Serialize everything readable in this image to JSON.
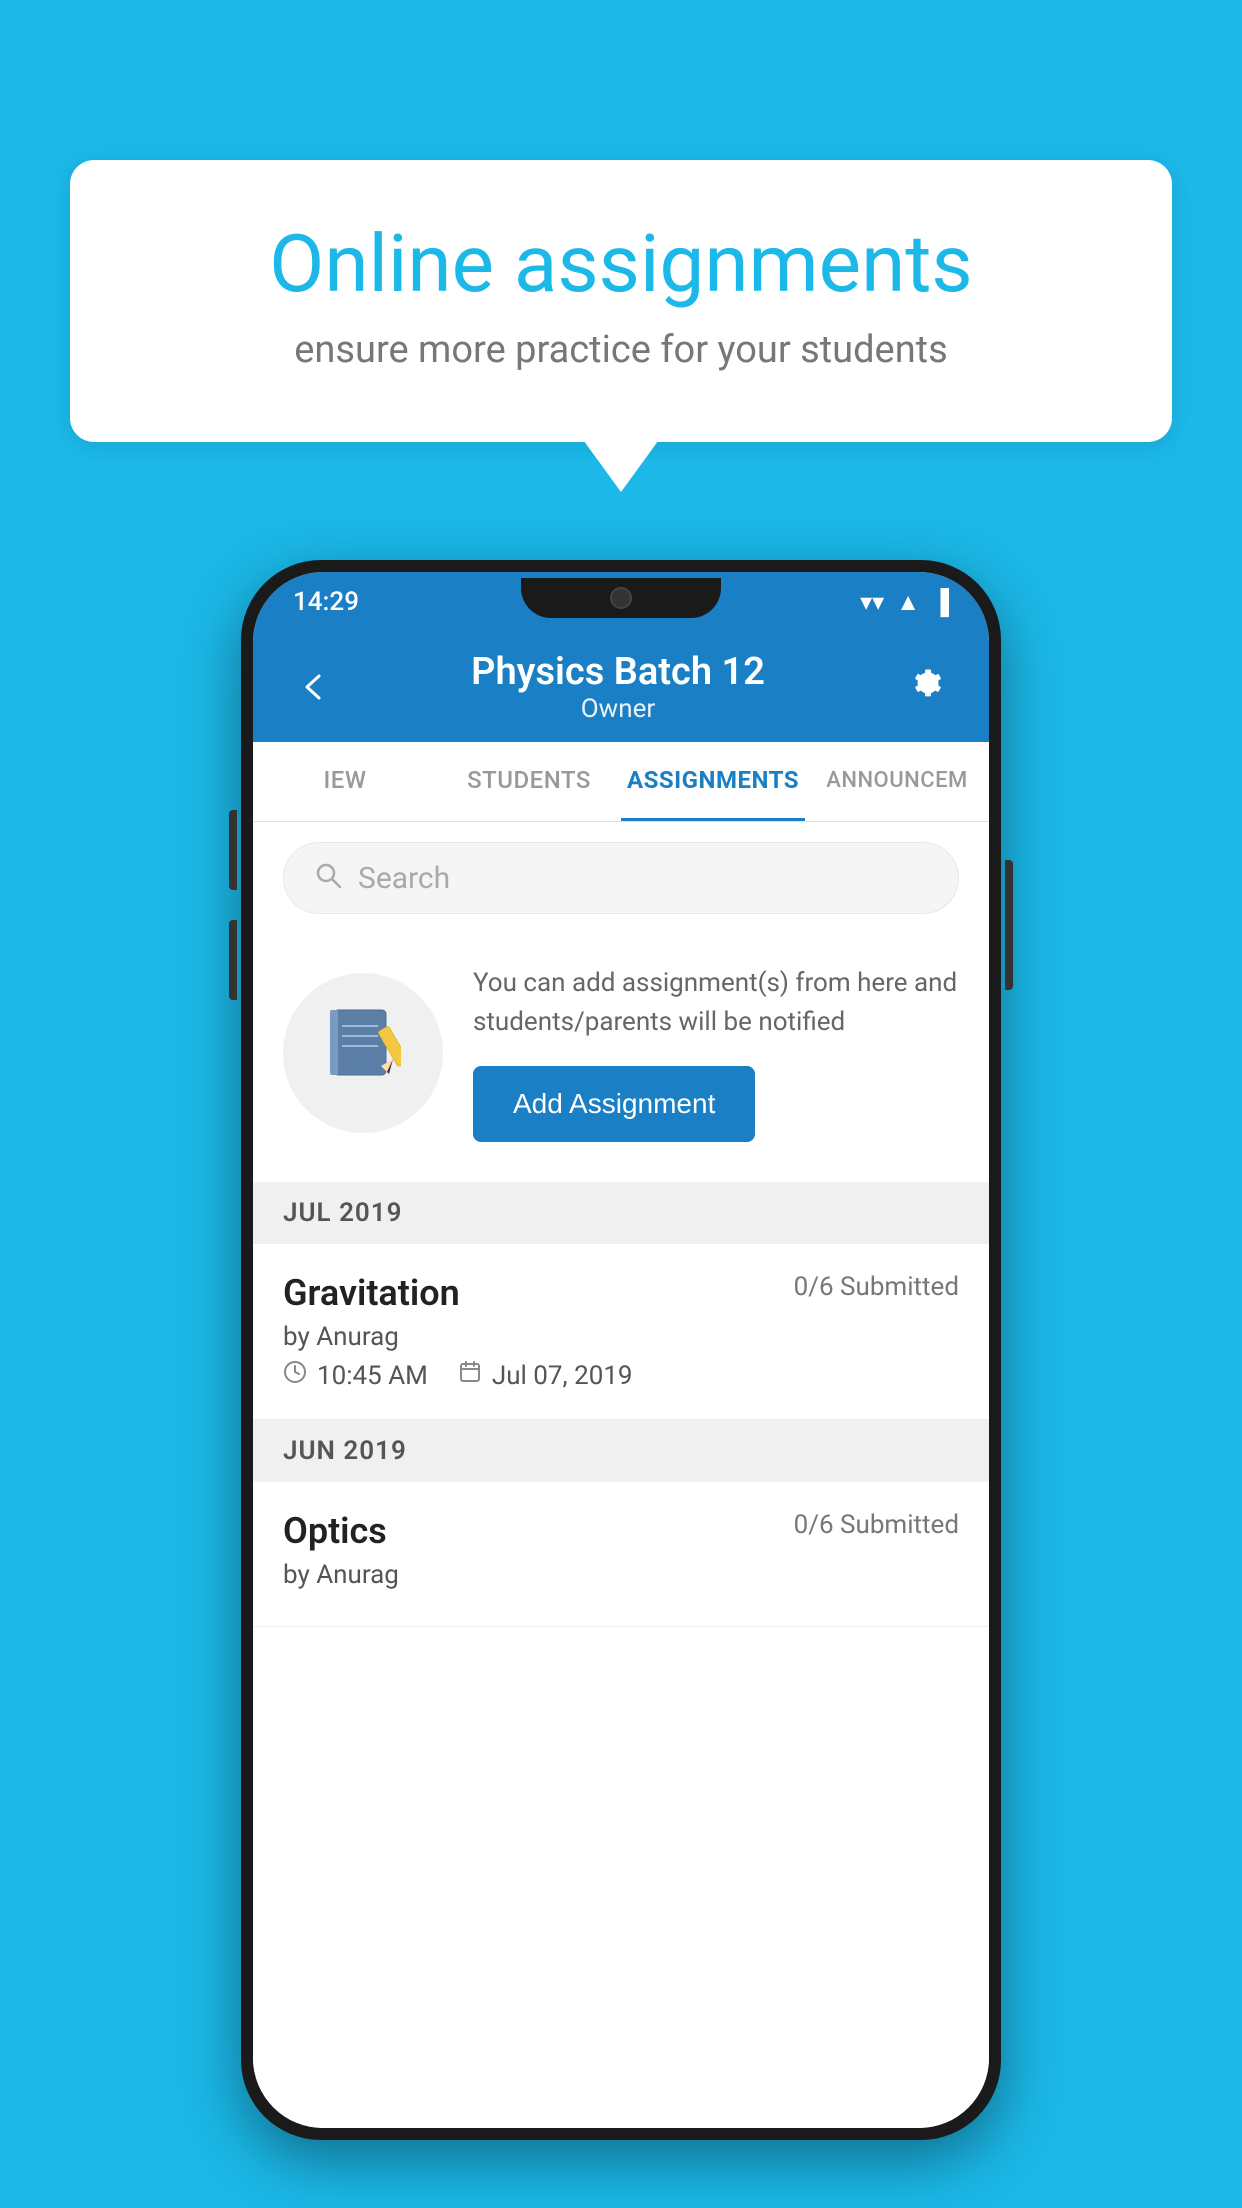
{
  "background": {
    "color": "#1BB8E8"
  },
  "speech_bubble": {
    "title": "Online assignments",
    "subtitle": "ensure more practice for your students"
  },
  "status_bar": {
    "time": "14:29",
    "wifi": "▼",
    "signal": "▲",
    "battery": "▐"
  },
  "top_bar": {
    "title": "Physics Batch 12",
    "subtitle": "Owner",
    "back_label": "←",
    "settings_label": "⚙"
  },
  "tabs": [
    {
      "label": "IEW",
      "active": false
    },
    {
      "label": "STUDENTS",
      "active": false
    },
    {
      "label": "ASSIGNMENTS",
      "active": true
    },
    {
      "label": "ANNOUNCEM",
      "active": false
    }
  ],
  "search": {
    "placeholder": "Search"
  },
  "add_assignment_card": {
    "description": "You can add assignment(s) from here and students/parents will be notified",
    "button_label": "Add Assignment"
  },
  "sections": [
    {
      "month": "JUL 2019",
      "assignments": [
        {
          "name": "Gravitation",
          "submitted": "0/6 Submitted",
          "by": "by Anurag",
          "time": "10:45 AM",
          "date": "Jul 07, 2019"
        }
      ]
    },
    {
      "month": "JUN 2019",
      "assignments": [
        {
          "name": "Optics",
          "submitted": "0/6 Submitted",
          "by": "by Anurag",
          "time": "",
          "date": ""
        }
      ]
    }
  ]
}
